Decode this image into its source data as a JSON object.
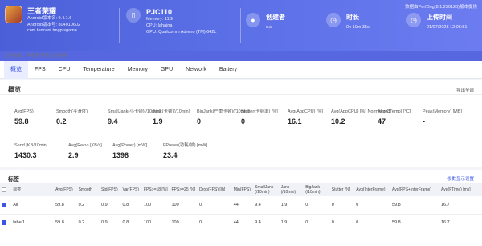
{
  "app": {
    "name": "王者荣耀",
    "android_version_name": "Android版本名: 9.4.1.6",
    "android_version_code": "Android版本号: 804010602",
    "package": "com.tencent.tmgp.sgame"
  },
  "device": {
    "model": "PJC110",
    "memory": "Memory: 11G",
    "cpu": "CPU: lahaina",
    "gpu": "GPU: Qualcomm Adreno (TM) 642L"
  },
  "creator": {
    "title": "创建者",
    "value": "s.s"
  },
  "duration": {
    "title": "时长",
    "value": "0h 10m 35s"
  },
  "upload": {
    "title": "上传时间",
    "value": "21/07/2023 12:06:51"
  },
  "version_note": "数据由PerfDog(8.1.230120)版本提供",
  "search": {
    "placeholder": "应用包名、手机型号等进行搜索"
  },
  "tabs": [
    "概览",
    "FPS",
    "CPU",
    "Temperature",
    "Memory",
    "GPU",
    "Network",
    "Battery"
  ],
  "overview": {
    "title": "概览",
    "export_label": "导出全部",
    "metrics_row1": [
      {
        "label": "Avg(FPS)",
        "value": "59.8"
      },
      {
        "label": "Smooth(平滑度)",
        "value": "0.2"
      },
      {
        "label": "SmallJank(小卡顿)(/10min)",
        "value": "9.4"
      },
      {
        "label": "Jank(卡顿)(/10min)",
        "value": "1.9"
      },
      {
        "label": "BigJank(严重卡顿)(/10min)",
        "value": "0"
      },
      {
        "label": "Stutter(卡顿率) [%]",
        "value": "0"
      },
      {
        "label": "Avg(AppCPU) [%]",
        "value": "16.1"
      },
      {
        "label": "Avg(AppCPU) [%] Normalized",
        "value": "10.2"
      },
      {
        "label": "Avg(CTemp) [°C]",
        "value": "47"
      },
      {
        "label": "Peak(Memory) [MB]",
        "value": "-"
      }
    ],
    "metrics_row2": [
      {
        "label": "Send [KB/10min]",
        "value": "1430.3"
      },
      {
        "label": "Avg(Recv) [KB/s]",
        "value": "2.9"
      },
      {
        "label": "Avg(Power) [mW]",
        "value": "1398"
      },
      {
        "label": "FPower(功耗/帧) [mW]",
        "value": "23.4"
      }
    ]
  },
  "labels": {
    "title": "标签",
    "link": "参数显示设置",
    "columns": [
      "标签",
      "Avg(FPS)",
      "Smooth",
      "Std(FPS)",
      "Var(FPS)",
      "FPS>=18 [%]",
      "FPS>=25 [%]",
      "Drop(FPS) [/h]",
      "Min(FPS)",
      "SmallJank (/10min)",
      "Jank (/10min)",
      "BigJank (/10min)",
      "Stutter [%]",
      "Avg(InterFrame)",
      "Avg(FPS+InterFrame)",
      "Avg(FTime) [ms]"
    ],
    "rows": [
      [
        "All",
        "59.8",
        "0.2",
        "0.9",
        "0.8",
        "100",
        "100",
        "0",
        "44",
        "9.4",
        "1.9",
        "0",
        "0",
        "0",
        "59.8",
        "16.7"
      ],
      [
        "label1",
        "59.8",
        "0.2",
        "0.9",
        "0.8",
        "100",
        "100",
        "0",
        "44",
        "9.4",
        "1.9",
        "0",
        "0",
        "0",
        "59.8",
        "16.7"
      ]
    ]
  }
}
